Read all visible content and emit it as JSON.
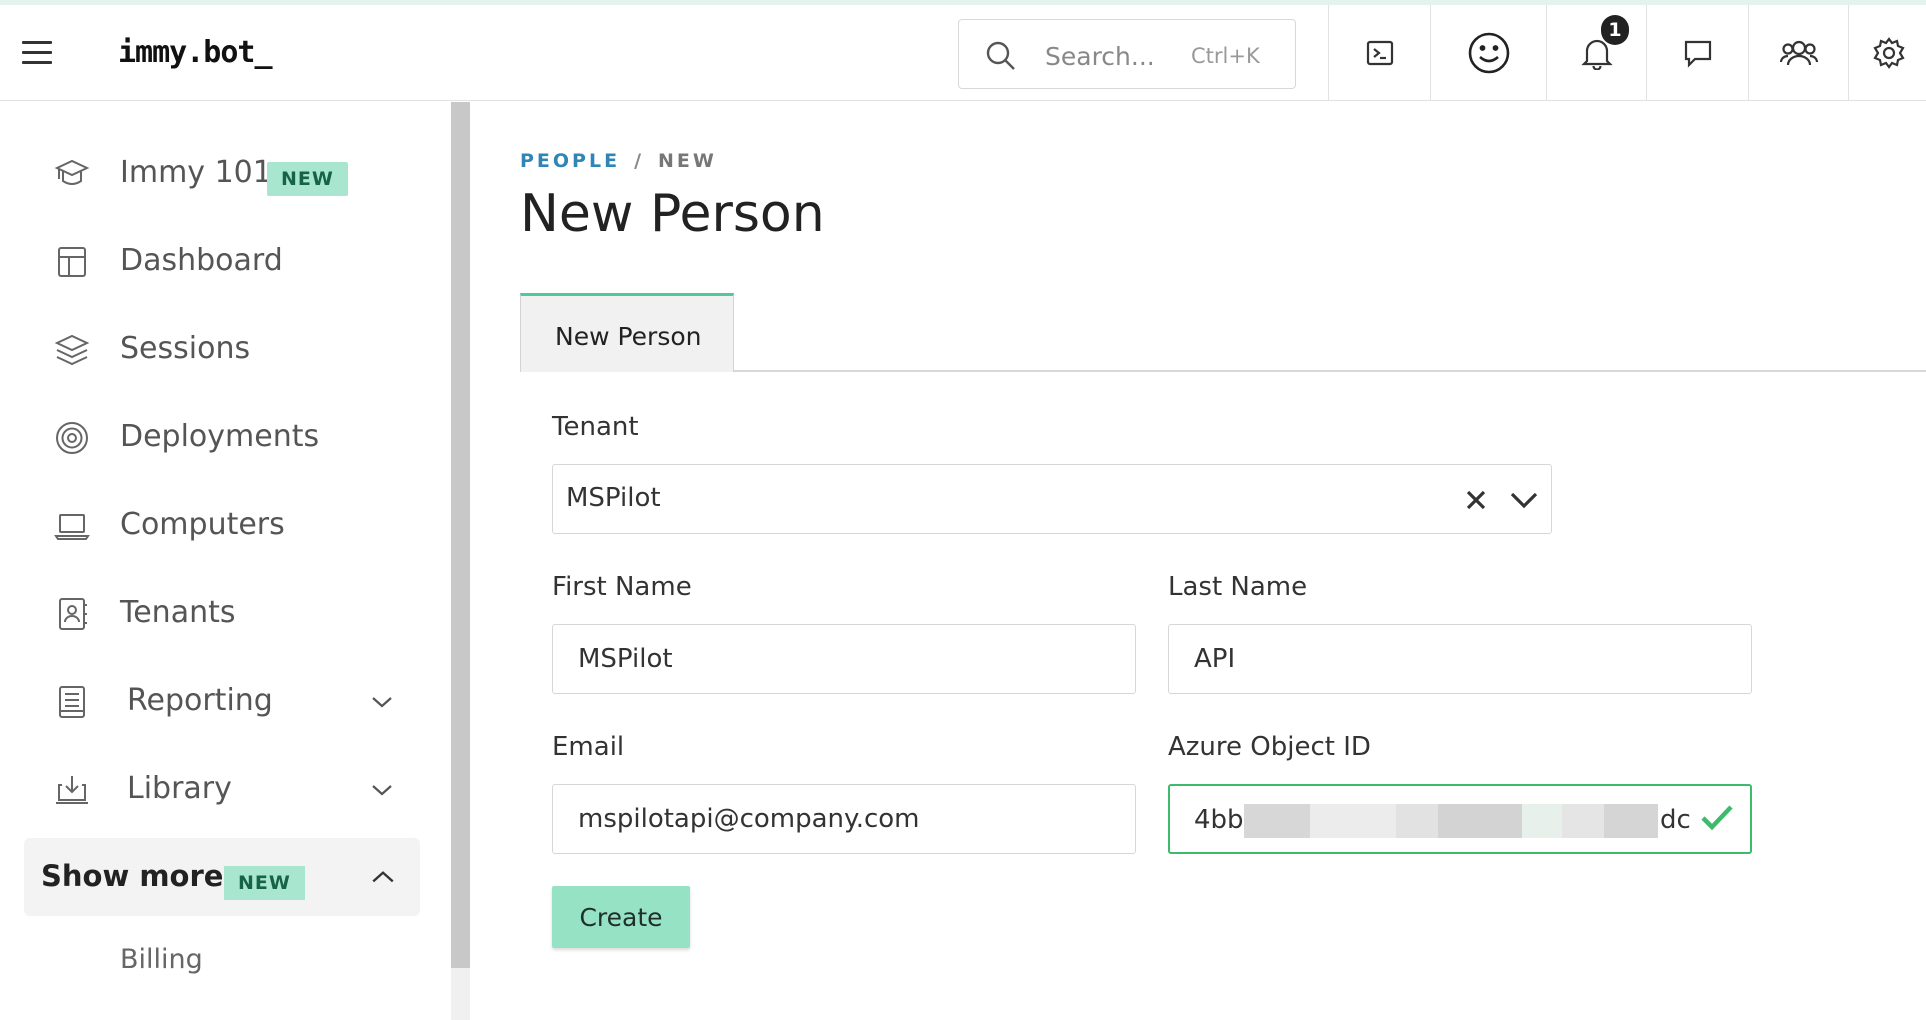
{
  "header": {
    "logo": "immy.bot_",
    "search": {
      "placeholder": "Search...",
      "shortcut": "Ctrl+K"
    },
    "notifications_count": "1"
  },
  "sidebar": {
    "items": [
      {
        "label": "Immy 101",
        "badge": "NEW",
        "icon": "graduation-cap-icon"
      },
      {
        "label": "Dashboard",
        "icon": "layout-icon"
      },
      {
        "label": "Sessions",
        "icon": "layers-icon"
      },
      {
        "label": "Deployments",
        "icon": "target-icon"
      },
      {
        "label": "Computers",
        "icon": "laptop-icon"
      },
      {
        "label": "Tenants",
        "icon": "contact-book-icon"
      },
      {
        "label": "Reporting",
        "icon": "report-icon",
        "expandable": true
      },
      {
        "label": "Library",
        "icon": "download-icon",
        "expandable": true
      }
    ],
    "show_more": {
      "label": "Show more",
      "badge": "NEW",
      "expanded": true
    },
    "sub_items": [
      {
        "label": "Billing"
      }
    ]
  },
  "breadcrumb": {
    "parent": "PEOPLE",
    "separator": "/",
    "current": "NEW"
  },
  "page_title": "New Person",
  "tabs": [
    {
      "label": "New Person",
      "active": true
    }
  ],
  "form": {
    "tenant": {
      "label": "Tenant",
      "value": "MSPilot"
    },
    "first_name": {
      "label": "First Name",
      "value": "MSPilot"
    },
    "last_name": {
      "label": "Last Name",
      "value": "API"
    },
    "email": {
      "label": "Email",
      "value": "mspilotapi@company.com"
    },
    "azure_object_id": {
      "label": "Azure Object ID",
      "value_start": "4bb",
      "value_end": "dc",
      "valid": true
    }
  },
  "create_button": "Create",
  "colors": {
    "accent": "#4dc99a",
    "badge_bg": "#a8e6cf",
    "link": "#2f86b6",
    "valid": "#3dba6a",
    "button_bg": "#96e2c4"
  }
}
